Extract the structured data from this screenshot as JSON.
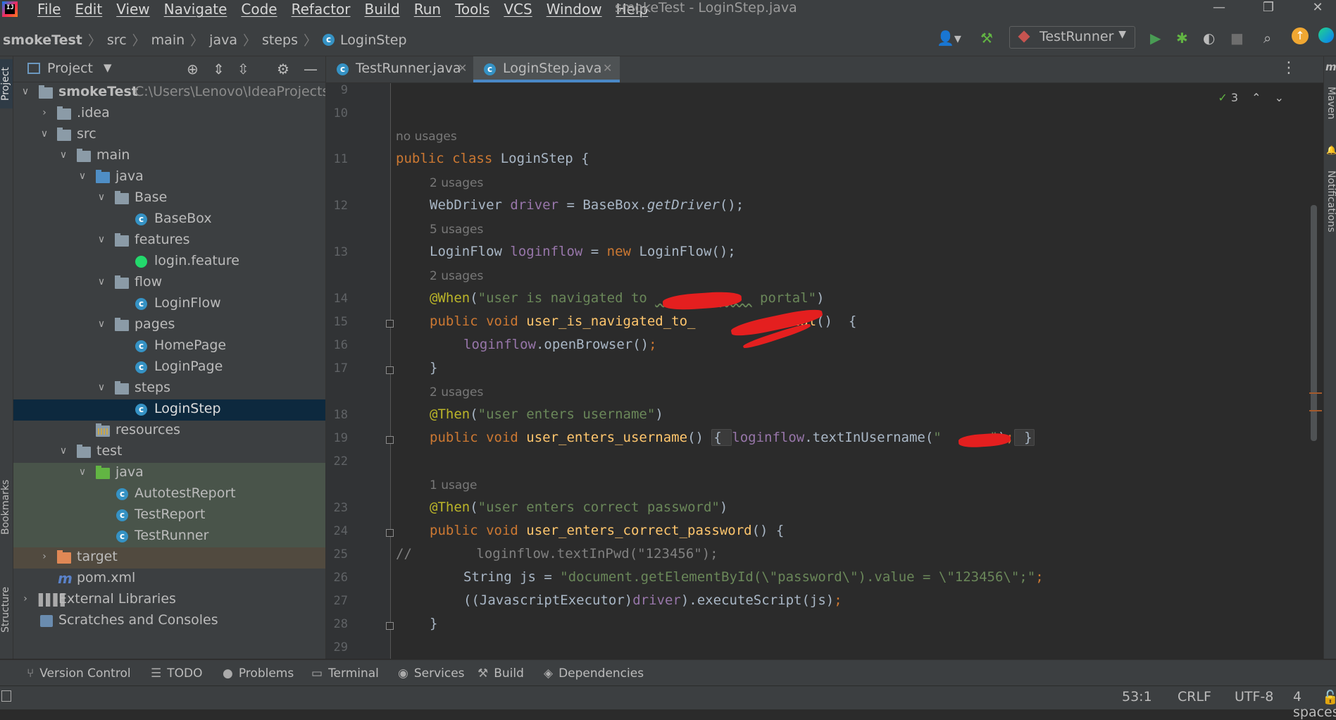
{
  "window": {
    "title": "smokeTest - LoginStep.java",
    "controls": [
      "—",
      "❐",
      "✕"
    ]
  },
  "menu": [
    "File",
    "Edit",
    "View",
    "Navigate",
    "Code",
    "Refactor",
    "Build",
    "Run",
    "Tools",
    "VCS",
    "Window",
    "Help"
  ],
  "breadcrumb": [
    "smokeTest",
    "src",
    "main",
    "java",
    "steps",
    "LoginStep"
  ],
  "toolbar": {
    "run_config": "TestRunner"
  },
  "project_panel": {
    "title": "Project",
    "tree": [
      {
        "label": "smokeTest",
        "path": "C:\\Users\\Lenovo\\IdeaProjects\\sn"
      },
      {
        "label": ".idea"
      },
      {
        "label": "src"
      },
      {
        "label": "main"
      },
      {
        "label": "java"
      },
      {
        "label": "Base"
      },
      {
        "label": "BaseBox"
      },
      {
        "label": "features"
      },
      {
        "label": "login.feature"
      },
      {
        "label": "flow"
      },
      {
        "label": "LoginFlow"
      },
      {
        "label": "pages"
      },
      {
        "label": "HomePage"
      },
      {
        "label": "LoginPage"
      },
      {
        "label": "steps"
      },
      {
        "label": "LoginStep"
      },
      {
        "label": "resources"
      },
      {
        "label": "test"
      },
      {
        "label": "java"
      },
      {
        "label": "AutotestReport"
      },
      {
        "label": "TestReport"
      },
      {
        "label": "TestRunner"
      },
      {
        "label": "target"
      },
      {
        "label": "pom.xml"
      },
      {
        "label": "External Libraries"
      },
      {
        "label": "Scratches and Consoles"
      }
    ]
  },
  "tabs": [
    {
      "label": "TestRunner.java",
      "active": false
    },
    {
      "label": "LoginStep.java",
      "active": true
    }
  ],
  "editor": {
    "inspection_count": "3",
    "line_numbers": [
      "9",
      "10",
      "11",
      "12",
      "13",
      "14",
      "15",
      "16",
      "17",
      "18",
      "19",
      "22",
      "23",
      "24",
      "25",
      "26",
      "27",
      "28",
      "29"
    ],
    "hints": {
      "h11": "no usages",
      "h12": "2 usages",
      "h13": "5 usages",
      "h14": "2 usages",
      "h18": "2 usages",
      "h23": "1 usage"
    },
    "code": {
      "l11a": "public class ",
      "l11b": "LoginStep {",
      "l12a": "WebDriver ",
      "l12b": "driver",
      "l12c": " = BaseBox.",
      "l12d": "getDriver",
      "l12e": "();",
      "l13a": "LoginFlow ",
      "l13b": "loginflow",
      "l13c": " = ",
      "l13d": "new ",
      "l13e": "LoginFlow();",
      "l14a": "@When",
      "l14b": "(",
      "l14c": "\"user is navigated to ",
      "l14d": "xxxxxxxxxxxx",
      "l14e": " portal\"",
      "l14f": ")",
      "l15a": "public void ",
      "l15b": "user_is_navigated_to_",
      "l15c": "xxxxxxxx",
      "l15d": "_portal",
      "l15e": "()  {",
      "l16a": "loginflow",
      "l16b": ".openBrowser()",
      "l16c": ";",
      "l17": "}",
      "l18a": "@Then",
      "l18b": "(",
      "l18c": "\"user enters username\"",
      "l18d": ")",
      "l19a": "public void ",
      "l19b": "user_enters_username",
      "l19c": "() ",
      "l19d": "{ ",
      "l19e": "loginflow",
      "l19f": ".textInUsername(",
      "l19g": "\"",
      "l19h": "xxxxxx",
      "l19i": "\"",
      "l19j": ")",
      "l19k": ";",
      "l19l": " }",
      "l23a": "@Then",
      "l23b": "(",
      "l23c": "\"user enters correct password\"",
      "l23d": ")",
      "l24a": "public void ",
      "l24b": "user_enters_correct_password",
      "l24c": "() {",
      "l25a": "//",
      "l25b": "        loginflow.textInPwd(\"123456\");",
      "l26a": "String js = ",
      "l26b": "\"document.getElementById(\\\"password\\\").value = \\\"123456\\\";\"",
      "l26c": ";",
      "l27a": "((JavascriptExecutor)",
      "l27b": "driver",
      "l27c": ").executeScript(js)",
      "l27d": ";",
      "l28": "}"
    }
  },
  "side_tabs": {
    "left_top": "Project",
    "left_bookmarks": "Bookmarks",
    "left_structure": "Structure",
    "right_maven": "Maven",
    "right_notifications": "Notifications"
  },
  "bottom_tools": [
    "Version Control",
    "TODO",
    "Problems",
    "Terminal",
    "Services",
    "Build",
    "Dependencies"
  ],
  "status": {
    "position": "53:1",
    "line_sep": "CRLF",
    "encoding": "UTF-8",
    "indent": "4 spaces"
  },
  "colors": {
    "keyword": "#cc7832",
    "field": "#9876aa",
    "string": "#6a8759",
    "annotation": "#bbb529",
    "method": "#ffc66d",
    "selection": "#0d293e"
  }
}
